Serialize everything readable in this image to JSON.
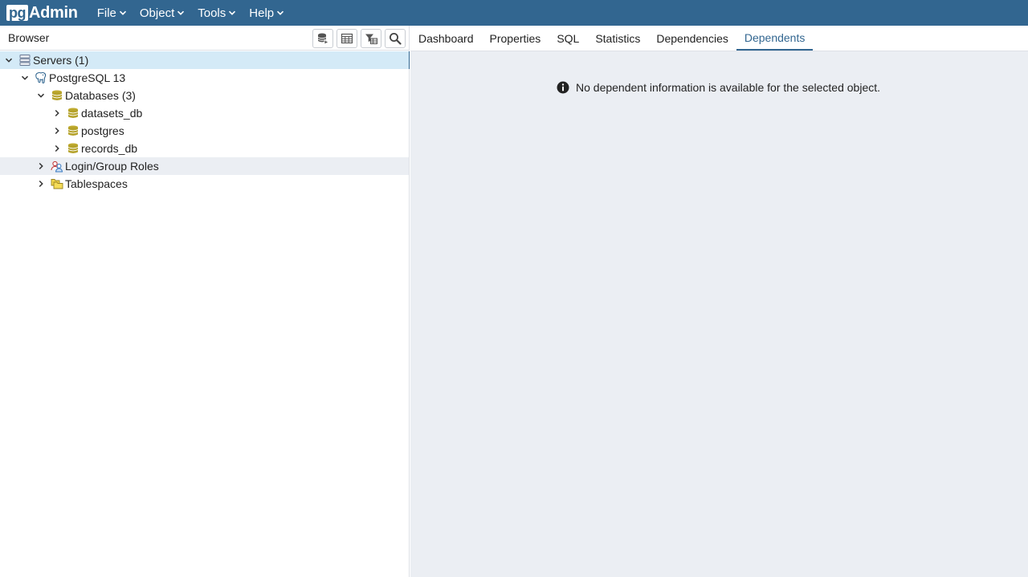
{
  "app": {
    "logo_pg": "pg",
    "logo_admin": "Admin"
  },
  "menu": [
    {
      "label": "File"
    },
    {
      "label": "Object"
    },
    {
      "label": "Tools"
    },
    {
      "label": "Help"
    }
  ],
  "browser": {
    "title": "Browser"
  },
  "tree": {
    "servers": "Servers (1)",
    "server": "PostgreSQL 13",
    "databases": "Databases (3)",
    "db1": "datasets_db",
    "db2": "postgres",
    "db3": "records_db",
    "roles": "Login/Group Roles",
    "tablespaces": "Tablespaces"
  },
  "tabs": [
    {
      "label": "Dashboard"
    },
    {
      "label": "Properties"
    },
    {
      "label": "SQL"
    },
    {
      "label": "Statistics"
    },
    {
      "label": "Dependencies"
    },
    {
      "label": "Dependents"
    }
  ],
  "content": {
    "message": "No dependent information is available for the selected object."
  },
  "colors": {
    "brand": "#326690",
    "selected_row": "#d4eaf7",
    "panel_bg": "#ebeef3",
    "db_icon": "#b5a22a"
  }
}
